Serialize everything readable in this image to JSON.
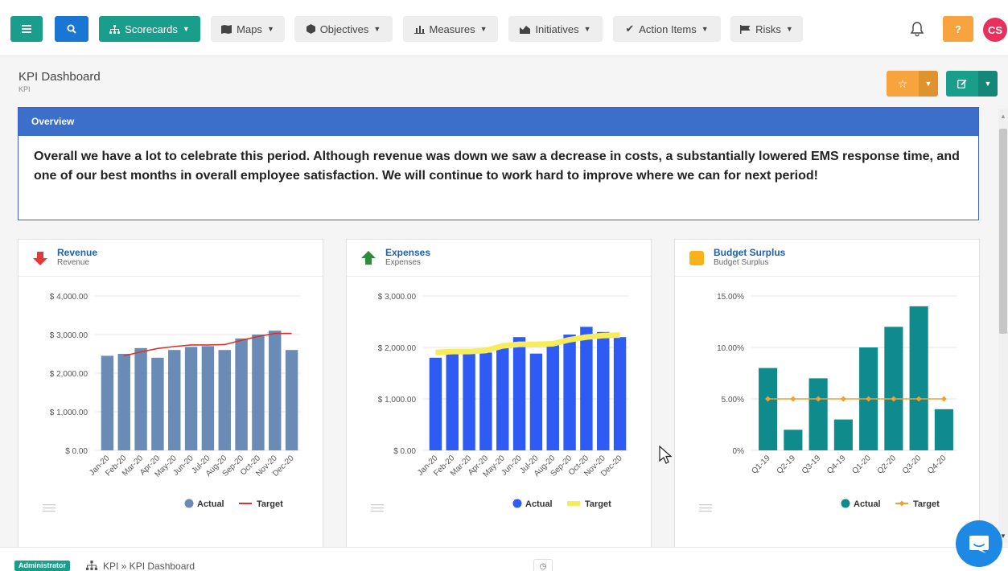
{
  "nav": {
    "menu_icon": "hamburger-icon",
    "search_icon": "search-icon",
    "items": [
      {
        "label": "Scorecards",
        "icon": "sitemap-icon"
      },
      {
        "label": "Maps",
        "icon": "map-icon"
      },
      {
        "label": "Objectives",
        "icon": "cube-icon"
      },
      {
        "label": "Measures",
        "icon": "bar-chart-icon"
      },
      {
        "label": "Initiatives",
        "icon": "area-chart-icon"
      },
      {
        "label": "Action Items",
        "icon": "check-icon"
      },
      {
        "label": "Risks",
        "icon": "flag-icon"
      }
    ],
    "help_label": "?",
    "avatar_initials": "CS"
  },
  "page": {
    "title": "KPI Dashboard",
    "subtitle": "KPI"
  },
  "overview": {
    "heading": "Overview",
    "text": "Overall we have a lot to celebrate this period. Although revenue was down we saw a decrease in costs, a substantially lowered EMS response time, and one of our best months in overall employee satisfaction. We will continue to work hard to improve where we can for next period!"
  },
  "cards": [
    {
      "title": "Revenue",
      "subtitle": "Revenue",
      "icon": "arrow-down-icon",
      "icon_color": "#e53935"
    },
    {
      "title": "Expenses",
      "subtitle": "Expenses",
      "icon": "arrow-up-icon",
      "icon_color": "#2e8b3a"
    },
    {
      "title": "Budget Surplus",
      "subtitle": "Budget Surplus",
      "icon": "square-icon",
      "icon_color": "#f9b21c"
    }
  ],
  "chart_data": [
    {
      "type": "bar",
      "title": "Revenue",
      "categories": [
        "Jan-20",
        "Feb-20",
        "Mar-20",
        "Apr-20",
        "May-20",
        "Jun-20",
        "Jul-20",
        "Aug-20",
        "Sep-20",
        "Oct-20",
        "Nov-20",
        "Dec-20"
      ],
      "series": [
        {
          "name": "Actual",
          "kind": "bar",
          "color": "#6a8bb5",
          "values": [
            2450,
            2500,
            2650,
            2400,
            2600,
            2680,
            2700,
            2600,
            2900,
            3000,
            3100,
            2600
          ]
        },
        {
          "name": "Target",
          "kind": "line",
          "color": "#d9342b",
          "values": [
            null,
            2450,
            2550,
            2640,
            2690,
            2730,
            2730,
            2740,
            2850,
            2950,
            3030,
            3030
          ]
        }
      ],
      "yticks": [
        "$ 0.00",
        "$ 1,000.00",
        "$ 2,000.00",
        "$ 3,000.00",
        "$ 4,000.00"
      ],
      "ylim": [
        0,
        4000
      ],
      "legend": "bottom-right"
    },
    {
      "type": "bar",
      "title": "Expenses",
      "categories": [
        "Jan-20",
        "Feb-20",
        "Mar-20",
        "Apr-20",
        "May-20",
        "Jun-20",
        "Jul-20",
        "Aug-20",
        "Sep-20",
        "Oct-20",
        "Nov-20",
        "Dec-20"
      ],
      "series": [
        {
          "name": "Actual",
          "kind": "bar",
          "color": "#2f5bf5",
          "values": [
            1800,
            1880,
            1880,
            1900,
            2000,
            2200,
            1880,
            2100,
            2250,
            2400,
            2300,
            2200
          ]
        },
        {
          "name": "Target",
          "kind": "line",
          "color": "#f7ec5c",
          "values": [
            1900,
            1920,
            1920,
            1940,
            2030,
            2060,
            2060,
            2070,
            2150,
            2200,
            2230,
            2240
          ]
        }
      ],
      "yticks": [
        "$ 0.00",
        "$ 1,000.00",
        "$ 2,000.00",
        "$ 3,000.00"
      ],
      "ylim": [
        0,
        3000
      ],
      "legend": "bottom-right"
    },
    {
      "type": "bar",
      "title": "Budget Surplus",
      "categories": [
        "Q1-19",
        "Q2-19",
        "Q3-19",
        "Q4-19",
        "Q1-20",
        "Q2-20",
        "Q3-20",
        "Q4-20"
      ],
      "series": [
        {
          "name": "Actual",
          "kind": "bar",
          "color": "#0f8b8d",
          "values": [
            8,
            2,
            7,
            3,
            10,
            12,
            14,
            4
          ]
        },
        {
          "name": "Target",
          "kind": "line",
          "color": "#f5a02b",
          "values": [
            5,
            5,
            5,
            5,
            5,
            5,
            5,
            5
          ]
        }
      ],
      "yticks": [
        "0%",
        "5.00%",
        "10.00%",
        "15.00%"
      ],
      "ylim": [
        0,
        15
      ],
      "legend": "bottom-right"
    }
  ],
  "footer": {
    "role": "Administrator",
    "breadcrumb": "KPI » KPI Dashboard"
  }
}
